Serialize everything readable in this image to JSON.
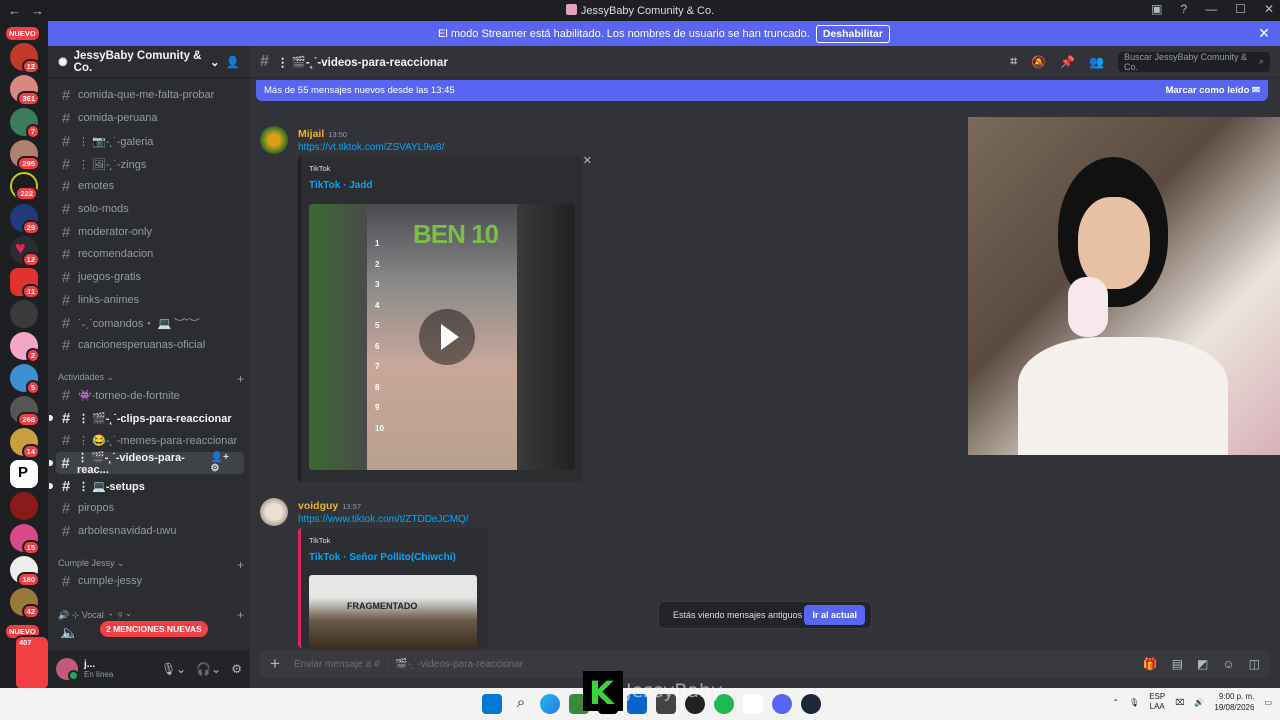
{
  "window": {
    "title": "JessyBaby Comunity & Co.",
    "nav_back": "←",
    "nav_forward": "→"
  },
  "streamer_banner": {
    "text": "El modo Streamer está habilitado. Los nombres de usuario se han truncado.",
    "button": "Deshabilitar"
  },
  "servers": {
    "new_label_top": "NUEVO",
    "new_label_bottom": "NUEVO",
    "badges": [
      "12",
      "361",
      "7",
      "295",
      "222",
      "29",
      "12",
      "11",
      "2",
      "5",
      "268",
      "14",
      "15",
      "180",
      "42",
      "407"
    ]
  },
  "sidebar": {
    "guild_name": "JessyBaby Comunity & Co.",
    "channels_top": [
      {
        "name": "comida-que-me-falta-probar"
      },
      {
        "name": "comida-peruana"
      },
      {
        "name": "⋮ 📷-˛˙-galeria"
      },
      {
        "name": "⋮ 🖼-˛˙-zings"
      },
      {
        "name": "emotes"
      },
      {
        "name": "solo-mods"
      },
      {
        "name": "moderator-only"
      },
      {
        "name": "recomendacion"
      },
      {
        "name": "juegos-gratis"
      },
      {
        "name": "links-animes"
      },
      {
        "name": "˙˗ˏˋcomandos・ 💻 ︶˘︶"
      },
      {
        "name": "cancionesperuanas-oficial"
      }
    ],
    "category_activities": "Actividades",
    "channels_activities": [
      {
        "name": "👾-torneo-de-fortnite"
      },
      {
        "name": "⋮ 🎬-˛˙-clips-para-reaccionar"
      },
      {
        "name": "⋮ 😂-˛˙-memes-para-reaccionar"
      },
      {
        "name": "⋮ 🎬-˛˙-videos-para-reac..."
      },
      {
        "name": "⋮ 💻-setups"
      },
      {
        "name": "piropos"
      },
      {
        "name": "arbolesnavidad-uwu"
      }
    ],
    "category_birthday": "Cumple Jessy",
    "channels_birthday": [
      {
        "name": "cumple-jessy"
      }
    ],
    "category_voice": "🔊 ⊹ Vocal ・ ୨",
    "mentions_pill": "2 MENCIONES NUEVAS",
    "user": {
      "name": "j...",
      "status": "En línea"
    }
  },
  "channel": {
    "name": "⋮ 🎬-˛˙-videos-para-reaccionar",
    "search_placeholder": "Buscar JessyBaby Comunity & Co.",
    "new_messages_text": "Más de 55 mensajes nuevos desde las 13:45",
    "mark_read": "Marcar como leído"
  },
  "messages": [
    {
      "author": "Mijail",
      "time": "13:50",
      "link": "https://vt.tiktok.com/ZSVAYL9w8/",
      "embed_provider": "TikTok",
      "embed_title": "TikTok · Jadd",
      "video_caption": "BEN 10",
      "list_numbers": [
        "1",
        "2",
        "3",
        "4",
        "5",
        "6",
        "7",
        "8",
        "9",
        "10"
      ]
    },
    {
      "author": "voidguy",
      "time": "13:57",
      "link": "https://www.tiktok.com/t/ZTDDeJCMQ/",
      "embed_provider": "TikTok",
      "embed_title": "TikTok · Señor Pollito(Chiwchi)",
      "thumb_text": "FRAGMENTADO"
    }
  ],
  "old_messages_toast": {
    "text": "Estás viendo mensajes antiguos",
    "button": "Ir al actual"
  },
  "composer": {
    "placeholder": "Enviar mensaje a # ⋮ 🎬-˛˙-videos-para-reaccionar"
  },
  "overlay": {
    "logo_letter": "K",
    "text": "JessyBaby"
  },
  "taskbar": {
    "lang_top": "ESP",
    "lang_bottom": "LAA",
    "time": "9:00 p. m.",
    "date": "19/08/2026"
  },
  "colors": {
    "accent": "#5865f2",
    "mention_red": "#f23f43",
    "author_gold": "#f0b232",
    "link": "#00a8fc"
  }
}
